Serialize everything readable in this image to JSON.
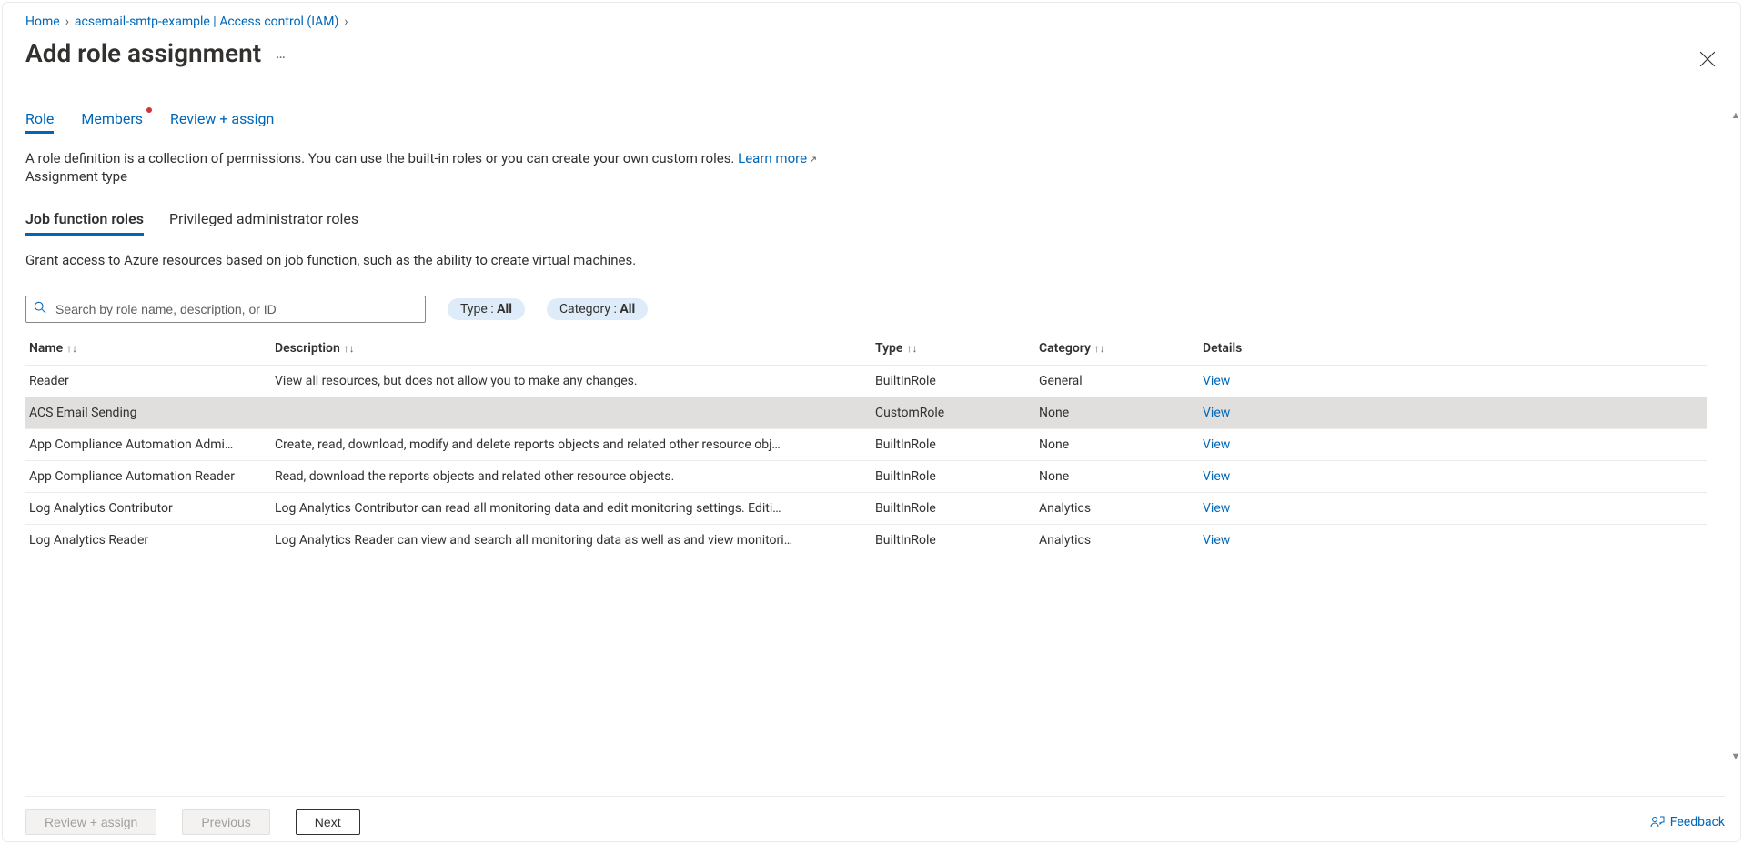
{
  "breadcrumb": {
    "home": "Home",
    "parent": "acsemail-smtp-example | Access control (IAM)"
  },
  "page_title": "Add role assignment",
  "wizard_tabs": {
    "role": "Role",
    "members": "Members",
    "review": "Review + assign"
  },
  "role_description": "A role definition is a collection of permissions. You can use the built-in roles or you can create your own custom roles.",
  "learn_more": "Learn more",
  "assignment_type_label": "Assignment type",
  "sub_tabs": {
    "job": "Job function roles",
    "priv": "Privileged administrator roles"
  },
  "grant_text": "Grant access to Azure resources based on job function, such as the ability to create virtual machines.",
  "search_placeholder": "Search by role name, description, or ID",
  "pills": {
    "type_label": "Type : ",
    "type_value": "All",
    "category_label": "Category : ",
    "category_value": "All"
  },
  "columns": {
    "name": "Name",
    "description": "Description",
    "type": "Type",
    "category": "Category",
    "details": "Details"
  },
  "view_label": "View",
  "rows": [
    {
      "name": "Reader",
      "description": "View all resources, but does not allow you to make any changes.",
      "type": "BuiltInRole",
      "category": "General"
    },
    {
      "name": "ACS Email Sending",
      "description": "",
      "type": "CustomRole",
      "category": "None",
      "selected": true
    },
    {
      "name": "App Compliance Automation Admi…",
      "description": "Create, read, download, modify and delete reports objects and related other resource obj…",
      "type": "BuiltInRole",
      "category": "None"
    },
    {
      "name": "App Compliance Automation Reader",
      "description": "Read, download the reports objects and related other resource objects.",
      "type": "BuiltInRole",
      "category": "None"
    },
    {
      "name": "Log Analytics Contributor",
      "description": "Log Analytics Contributor can read all monitoring data and edit monitoring settings. Editi…",
      "type": "BuiltInRole",
      "category": "Analytics"
    },
    {
      "name": "Log Analytics Reader",
      "description": "Log Analytics Reader can view and search all monitoring data as well as and view monitori…",
      "type": "BuiltInRole",
      "category": "Analytics",
      "last": true
    }
  ],
  "footer": {
    "review": "Review + assign",
    "previous": "Previous",
    "next": "Next",
    "feedback": "Feedback"
  }
}
